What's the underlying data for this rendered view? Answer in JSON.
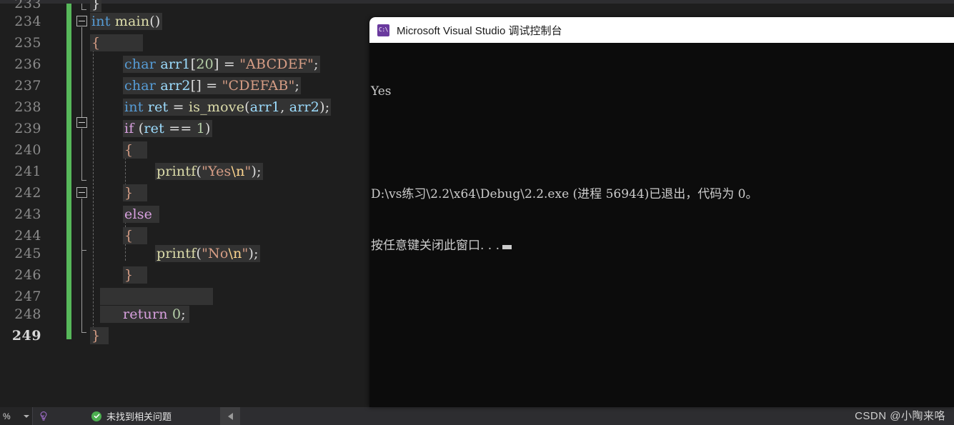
{
  "editor": {
    "change_bar_color": "#57b85a",
    "background": "#1e1e1e",
    "current_line": "249",
    "lines": [
      {
        "num": "233",
        "indent": 0,
        "partial": true
      },
      {
        "num": "234",
        "indent": 0
      },
      {
        "num": "235",
        "indent": 0
      },
      {
        "num": "236",
        "indent": 1
      },
      {
        "num": "237",
        "indent": 1
      },
      {
        "num": "238",
        "indent": 1
      },
      {
        "num": "239",
        "indent": 1
      },
      {
        "num": "240",
        "indent": 1
      },
      {
        "num": "241",
        "indent": 2
      },
      {
        "num": "242",
        "indent": 1
      },
      {
        "num": "243",
        "indent": 1
      },
      {
        "num": "244",
        "indent": 1
      },
      {
        "num": "245",
        "indent": 2
      },
      {
        "num": "246",
        "indent": 1
      },
      {
        "num": "247",
        "indent": 1
      },
      {
        "num": "248",
        "indent": 1
      },
      {
        "num": "249",
        "indent": 0
      }
    ],
    "code_text": {
      "l233": "}",
      "l234": "int main()",
      "l235": "{",
      "l236": "char arr1[20] = \"ABCDEF\";",
      "l237": "char arr2[] = \"CDEFAB\";",
      "l238": "int ret = is_move(arr1, arr2);",
      "l239": "if (ret == 1)",
      "l240": "{",
      "l241": "printf(\"Yes\\n\");",
      "l242": "}",
      "l243": "else",
      "l244": "{",
      "l245": "printf(\"No\\n\");",
      "l246": "}",
      "l247": "",
      "l248": "return 0;",
      "l249": "}"
    },
    "tokens": {
      "kw_int": "int",
      "kw_char": "char",
      "fn_main": "main",
      "fn_printf": "printf",
      "fn_is_move": "is_move",
      "ctl_if": "if",
      "ctl_else": "else",
      "ctl_return": "return",
      "var_arr1": "arr1",
      "var_arr2": "arr2",
      "var_ret": "ret",
      "num_20": "20",
      "num_1": "1",
      "num_0": "0",
      "str_abcdef": "\"ABCDEF\"",
      "str_cdefab": "\"CDEFAB\"",
      "str_yes": "\"Yes",
      "str_no": "\"No",
      "esc_n": "\\n",
      "quote_close": "\"",
      "brace_open": "{",
      "brace_close": "}",
      "semi": ";",
      "paren_empty": "()",
      "bracket_20": "[",
      "bracket_close": "]",
      "bracket_empty": "[]",
      "eq": "=",
      "eqeq": "==",
      "comma": ",",
      "lparen": "(",
      "rparen": ")"
    },
    "colors": {
      "keyword": "#569cd6",
      "control": "#d8a0df",
      "identifier": "#9cdcfe",
      "function": "#dcdcaa",
      "number": "#b5cea8",
      "string": "#d69d85",
      "escape": "#ffd68f",
      "punctuation": "#dcdcdc"
    }
  },
  "statusbar": {
    "zoom_value": "%",
    "bulb_icon": "lightbulb-icon",
    "ok_icon": "check-circle-icon",
    "message": "未找到相关问题",
    "scroll_left_icon": "triangle-left-icon"
  },
  "console": {
    "icon_label": "C:\\",
    "title": "Microsoft Visual Studio 调试控制台",
    "output_lines": [
      "Yes",
      "",
      "D:\\vs练习\\2.2\\x64\\Debug\\2.2.exe (进程 56944)已退出，代码为 0。",
      "按任意键关闭此窗口. . ."
    ],
    "background": "#0c0c0c",
    "title_background": "#ffffff"
  },
  "watermark": {
    "text": "CSDN @小陶来咯"
  }
}
